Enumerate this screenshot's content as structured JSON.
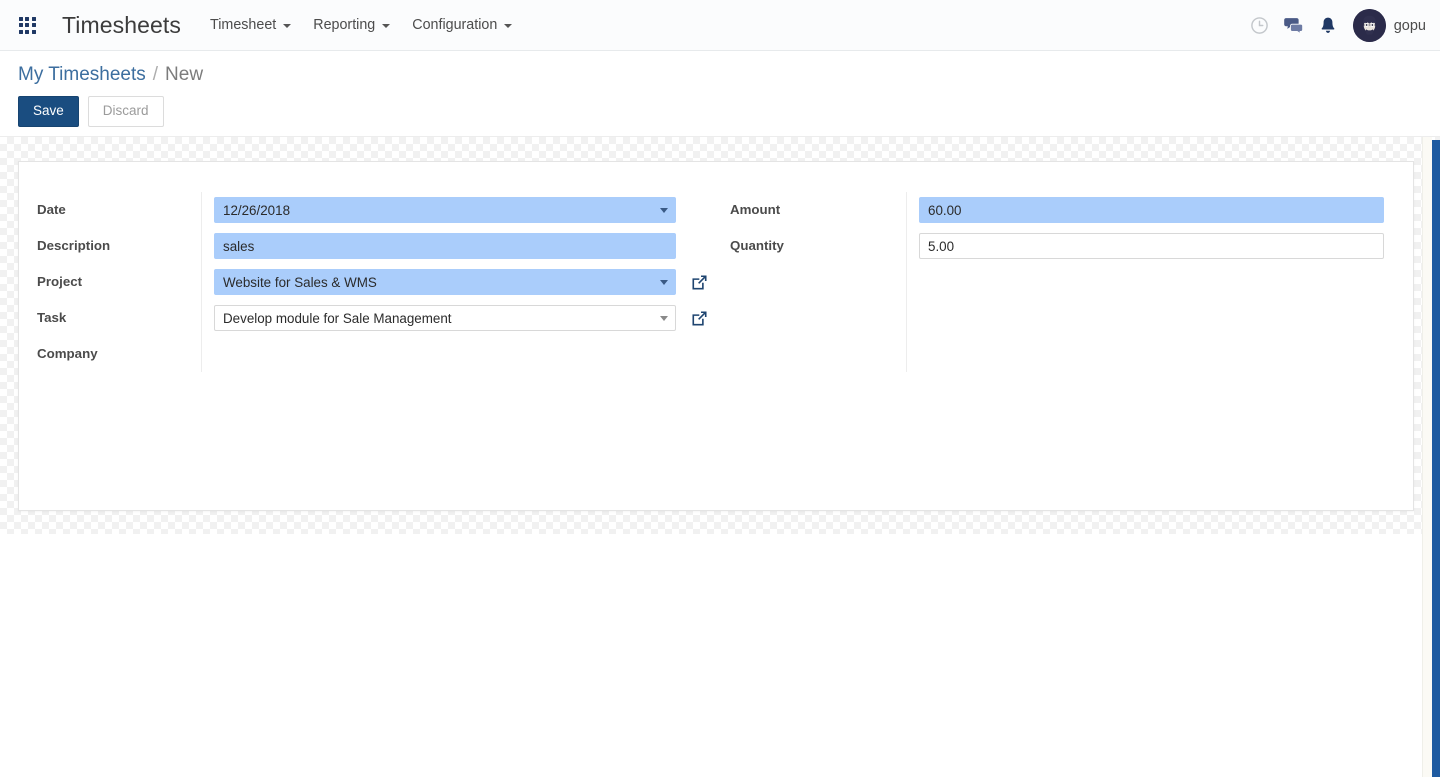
{
  "navbar": {
    "apps_icon": "apps-grid-icon",
    "brand": "Timesheets",
    "menus": [
      {
        "label": "Timesheet",
        "has_caret": true
      },
      {
        "label": "Reporting",
        "has_caret": true
      },
      {
        "label": "Configuration",
        "has_caret": true
      }
    ],
    "right_icons": [
      {
        "name": "activity-clock-icon",
        "glyph": "clock"
      },
      {
        "name": "messages-chat-icon",
        "glyph": "chat"
      },
      {
        "name": "notifications-bell-icon",
        "glyph": "bell"
      }
    ],
    "username": "gopu",
    "accent_color": "#1f3864"
  },
  "control_panel": {
    "breadcrumb": {
      "parent": "My Timesheets",
      "separator": "/",
      "current": "New"
    },
    "save_label": "Save",
    "discard_label": "Discard",
    "save_color": "#1a4d80"
  },
  "form": {
    "left": [
      {
        "label": "Date",
        "value": "12/26/2018",
        "style": "blue",
        "widget": "date-dropdown",
        "caret": true,
        "external_link": false
      },
      {
        "label": "Description",
        "value": "sales",
        "style": "blue",
        "widget": "text-input",
        "caret": false,
        "external_link": false
      },
      {
        "label": "Project",
        "value": "Website for Sales & WMS",
        "style": "blue",
        "widget": "many2one-dropdown",
        "caret": true,
        "external_link": true
      },
      {
        "label": "Task",
        "value": "Develop module for Sale Management",
        "style": "white",
        "widget": "many2one-dropdown",
        "caret": true,
        "external_link": true
      },
      {
        "label": "Company",
        "value": "",
        "style": "empty",
        "widget": "many2one-dropdown",
        "caret": false,
        "external_link": false
      }
    ],
    "right": [
      {
        "label": "Amount",
        "value": "60.00",
        "style": "blue",
        "widget": "monetary-input",
        "caret": false,
        "external_link": false
      },
      {
        "label": "Quantity",
        "value": "5.00",
        "style": "white",
        "widget": "float-input",
        "caret": false,
        "external_link": false
      }
    ],
    "highlight_color": "#aacdfb"
  },
  "scrollbar": {
    "name": "vertical-scrollbar",
    "color": "#1e5aa0"
  }
}
